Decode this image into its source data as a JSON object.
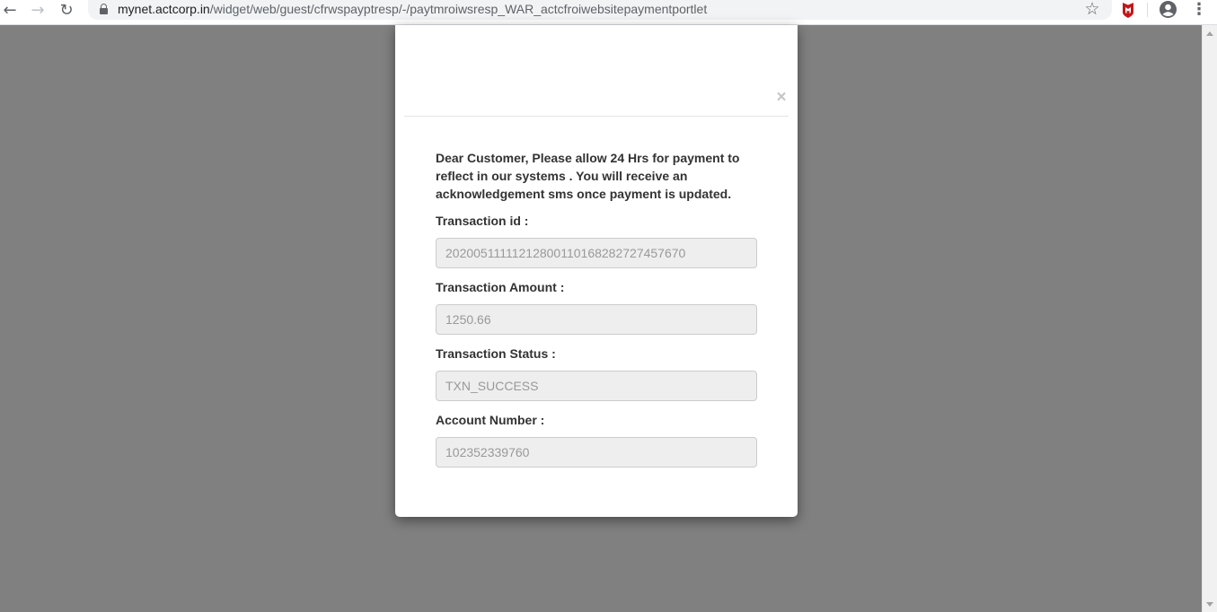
{
  "browser": {
    "url_host": "mynet.actcorp.in",
    "url_path": "/widget/web/guest/cfrwspayptresp/-/paytmroiwsresp_WAR_actcfroiwebsitepaymentportlet",
    "back_glyph": "←",
    "forward_glyph": "→",
    "reload_glyph": "↻",
    "star_glyph": "☆",
    "menu_glyph": "⋮"
  },
  "modal": {
    "close_label": "×",
    "notice": "Dear Customer, Please allow 24 Hrs for payment to reflect in our systems . You will receive an acknowledgement sms once payment is updated.",
    "fields": [
      {
        "label": "Transaction id :",
        "value": "202005111112128001101682827274576 70"
      },
      {
        "label": "Transaction Amount :",
        "value": "1250.66"
      },
      {
        "label": "Transaction Status :",
        "value": "TXN_SUCCESS"
      },
      {
        "label": "Account Number :",
        "value": "102352339760"
      }
    ]
  },
  "colors": {
    "overlay": "#808080",
    "mcafee_red": "#c01818",
    "label_text": "#333333",
    "input_bg": "#eeeeee",
    "input_text": "#999999"
  }
}
